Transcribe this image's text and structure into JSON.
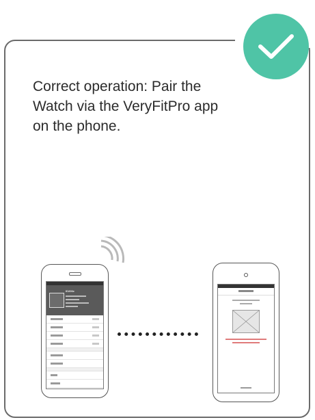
{
  "instruction": {
    "caption": "Correct operation: Pair the Watch via the VeryFitPro app on the phone.",
    "badge_icon": "checkmark-icon",
    "badge_color": "#4fc4a6"
  },
  "left_phone": {
    "device_name": "ID206e"
  },
  "icons": {
    "signal": "wireless-signal-icon",
    "connection": "dotted-connection-line"
  }
}
